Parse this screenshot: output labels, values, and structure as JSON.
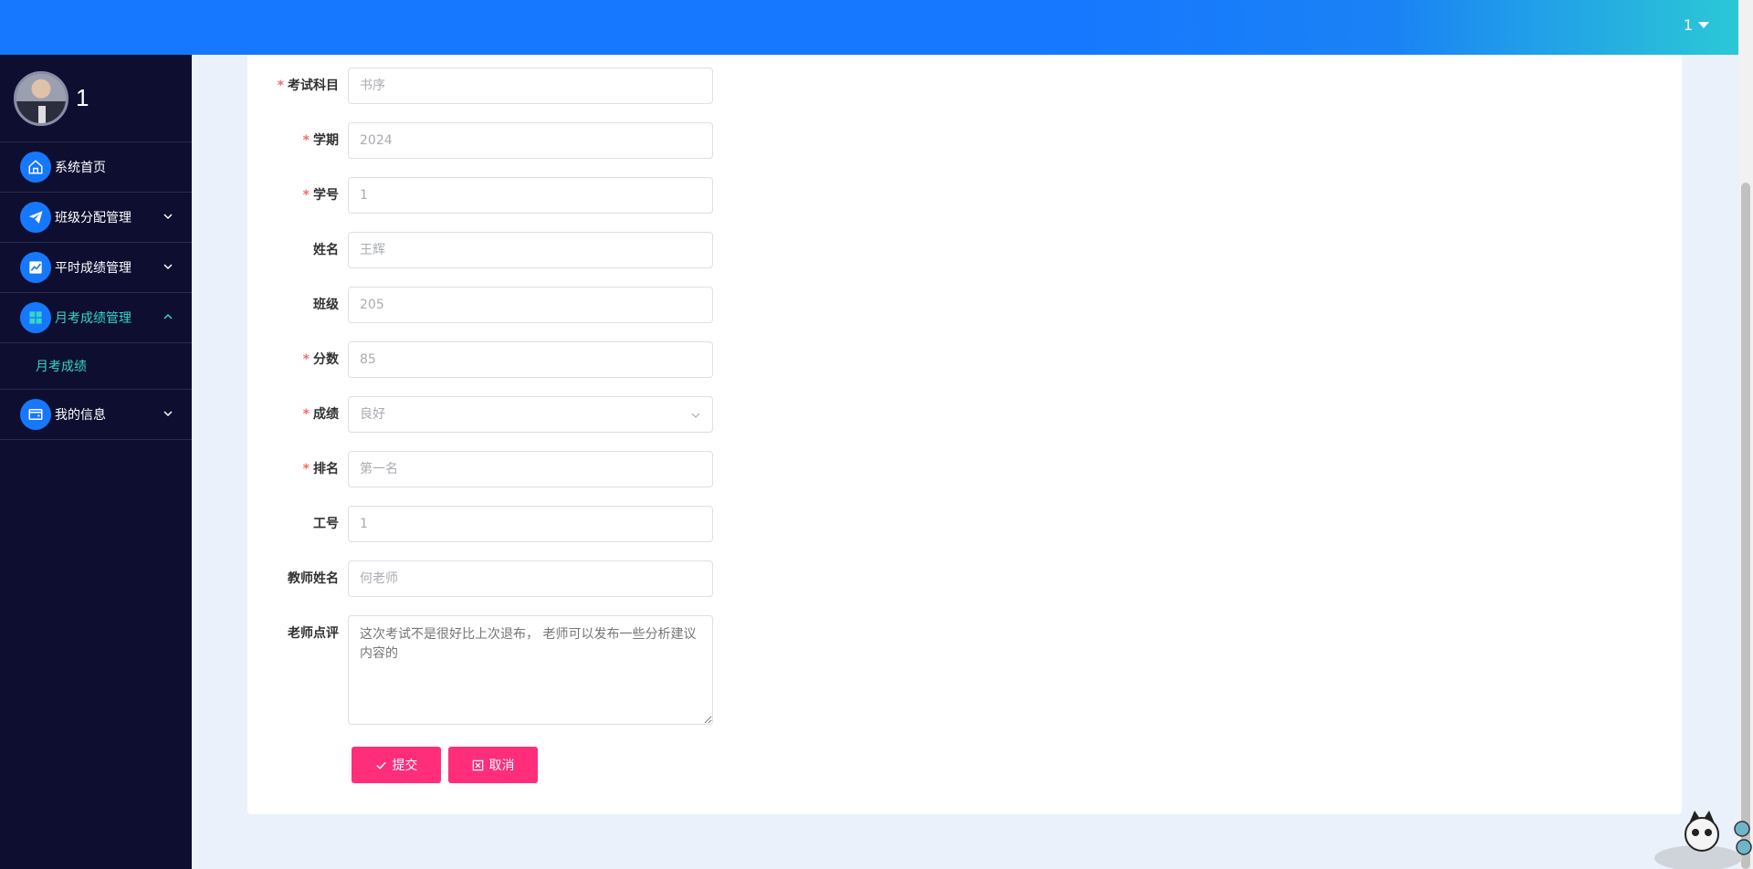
{
  "header": {
    "user_label": "1"
  },
  "sidebar": {
    "profile_name": "1",
    "items": [
      {
        "label": "系统首页",
        "icon": "home-icon"
      },
      {
        "label": "班级分配管理",
        "icon": "paper-plane-icon"
      },
      {
        "label": "平时成绩管理",
        "icon": "chart-icon"
      },
      {
        "label": "月考成绩管理",
        "icon": "grid-icon"
      },
      {
        "label": "我的信息",
        "icon": "wallet-icon"
      }
    ],
    "submenu": {
      "label": "月考成绩"
    }
  },
  "form": {
    "subject": {
      "label": "考试科目",
      "value": "书序"
    },
    "term": {
      "label": "学期",
      "value": "2024"
    },
    "student_id": {
      "label": "学号",
      "value": "1"
    },
    "name": {
      "label": "姓名",
      "value": "王辉"
    },
    "class": {
      "label": "班级",
      "value": "205"
    },
    "score": {
      "label": "分数",
      "value": "85"
    },
    "grade": {
      "label": "成绩",
      "value": "良好"
    },
    "rank": {
      "label": "排名",
      "value": "第一名"
    },
    "staff_id": {
      "label": "工号",
      "value": "1"
    },
    "teacher": {
      "label": "教师姓名",
      "value": "何老师"
    },
    "comment": {
      "label": "老师点评",
      "value": "这次考试不是很好比上次退布， 老师可以发布一些分析建议内容的"
    },
    "submit_label": "提交",
    "cancel_label": "取消"
  },
  "colors": {
    "accent": "#1677ff",
    "button": "#ff2d7a",
    "sidebar_bg": "#0e0f30",
    "active_text": "#33d6c7"
  }
}
